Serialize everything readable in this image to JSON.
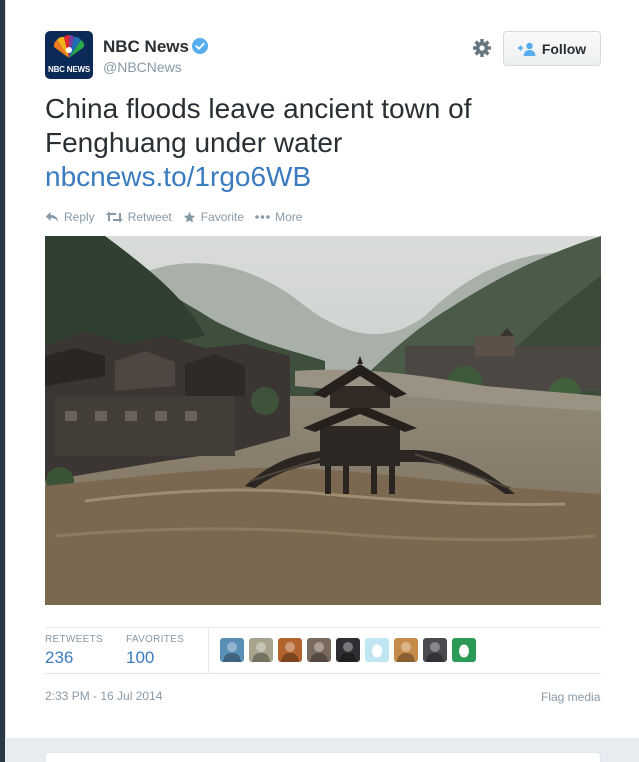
{
  "header": {
    "name": "NBC News",
    "handle": "@NBCNews",
    "avatar_text": "NBC NEWS",
    "follow_label": "Follow"
  },
  "tweet": {
    "text_line1": "China floods leave ancient town of",
    "text_line2": "Fenghuang under water",
    "link": "nbcnews.to/1rgo6WB"
  },
  "actions": {
    "reply": "Reply",
    "retweet": "Retweet",
    "favorite": "Favorite",
    "more": "More"
  },
  "stats": {
    "retweets_label": "RETWEETS",
    "retweets_value": "236",
    "favorites_label": "FAVORITES",
    "favorites_value": "100"
  },
  "favoriter_avatars": [
    {
      "color": "#5a8fb5"
    },
    {
      "color": "#a7a38c"
    },
    {
      "color": "#b2632e"
    },
    {
      "color": "#7a6a5d"
    },
    {
      "color": "#2f2f33"
    },
    {
      "color": "#bfe6f2"
    },
    {
      "color": "#c68a4a"
    },
    {
      "color": "#4a4a4f"
    },
    {
      "color": "#2b9a57"
    }
  ],
  "footer": {
    "timestamp": "2:33 PM - 16 Jul 2014",
    "flag_media": "Flag media"
  },
  "colors": {
    "link": "#3b7bbf",
    "muted": "#8899a6",
    "verified": "#55acee",
    "page_background": "#2a3744"
  },
  "icons": [
    "nbc-peacock-icon",
    "verified-badge-icon",
    "gear-icon",
    "follow-person-icon",
    "reply-icon",
    "retweet-icon",
    "favorite-star-icon",
    "more-dots-icon"
  ]
}
